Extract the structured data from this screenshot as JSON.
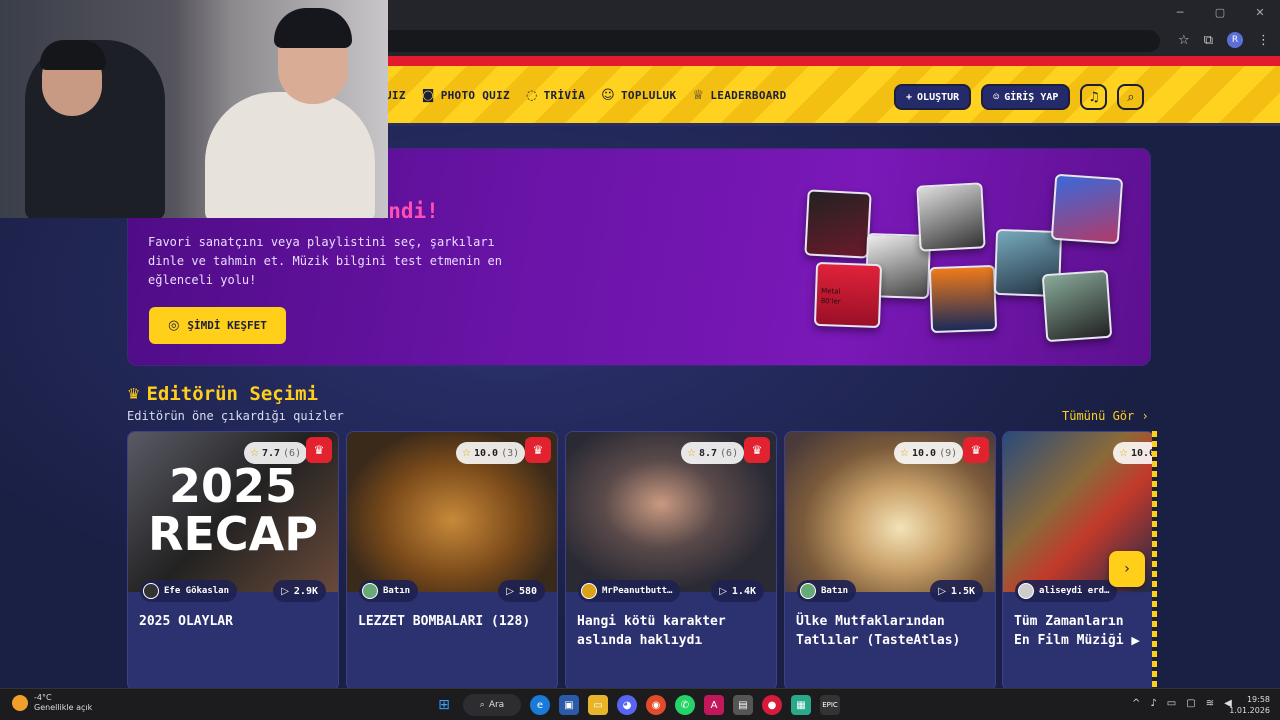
{
  "browser": {
    "controls": {
      "minimize": "─",
      "maximize": "▢",
      "close": "✕"
    },
    "profile_initial": "R"
  },
  "nav": {
    "items": [
      {
        "icon": "quiz-icon",
        "label": "UIZ",
        "glyph": ""
      },
      {
        "icon": "camera-icon",
        "label": "PHOTO QUIZ",
        "glyph": "📷"
      },
      {
        "icon": "chat-icon",
        "label": "TRİVİA",
        "glyph": "💬"
      },
      {
        "icon": "users-icon",
        "label": "TOPLULUK",
        "glyph": "👥"
      },
      {
        "icon": "trophy-icon",
        "label": "LEADERBOARD",
        "glyph": "🏆"
      }
    ],
    "create_label": "OLUŞTUR",
    "create_icon": "+",
    "login_label": "GİRİŞ YAP",
    "login_icon": "👤",
    "bell_icon": "🔔",
    "search_icon": "⌕"
  },
  "hero": {
    "title": "...... ...........endi!",
    "description": "Favori sanatçını veya playlistini seç, şarkıları dinle ve tahmin et. Müzik bilgini test etmenin en eğlenceli yolu!",
    "cta_label": "ŞİMDİ KEŞFET",
    "cta_icon": "◎",
    "thumbnail_text": [
      "Metal",
      "80'ler"
    ]
  },
  "section": {
    "title": "Editörün Seçimi",
    "subtitle": "Editörün öne çıkardığı quizler",
    "see_all": "Tümünü Gör ›",
    "crown_icon": "♛"
  },
  "cards": [
    {
      "rating": "7.7",
      "count": "(6)",
      "author": "Efe Gökaslan",
      "plays": "2.9K",
      "title": "2025 OLAYLAR",
      "image_text_1": "2025",
      "image_text_2": "RECAP",
      "title_icon": ""
    },
    {
      "rating": "10.0",
      "count": "(3)",
      "author": "Batın",
      "plays": "580",
      "title": "LEZZET BOMBALARI (128)",
      "title_icon": ""
    },
    {
      "rating": "8.7",
      "count": "(6)",
      "author": "MrPeanutbutt…",
      "plays": "1.4K",
      "title": "Hangi kötü karakter aslında haklıydı",
      "title_icon": ""
    },
    {
      "rating": "10.0",
      "count": "(9)",
      "author": "Batın",
      "plays": "1.5K",
      "title": "Ülke Mutfaklarından Tatlılar (TasteAtlas)",
      "title_icon": ""
    },
    {
      "rating": "10.0",
      "count": "",
      "author": "aliseydi erd…",
      "plays": "",
      "title": "Tüm Zamanların En Film Müziği",
      "title_icon": "▶"
    }
  ],
  "carousel": {
    "next_icon": "›"
  },
  "taskbar": {
    "temperature": "-4°C",
    "weather_text": "Genellikle açık",
    "search_label": "Ara",
    "time": "19:58",
    "date": "1.01.2026"
  },
  "colors": {
    "accent_yellow": "#ffcf1a",
    "nav_navy": "#252b6a",
    "hero_purple": "#6a14a8",
    "hero_title_pink": "#ff4fb2",
    "crown_red": "#e2222f",
    "bg": "#1a1f44"
  }
}
